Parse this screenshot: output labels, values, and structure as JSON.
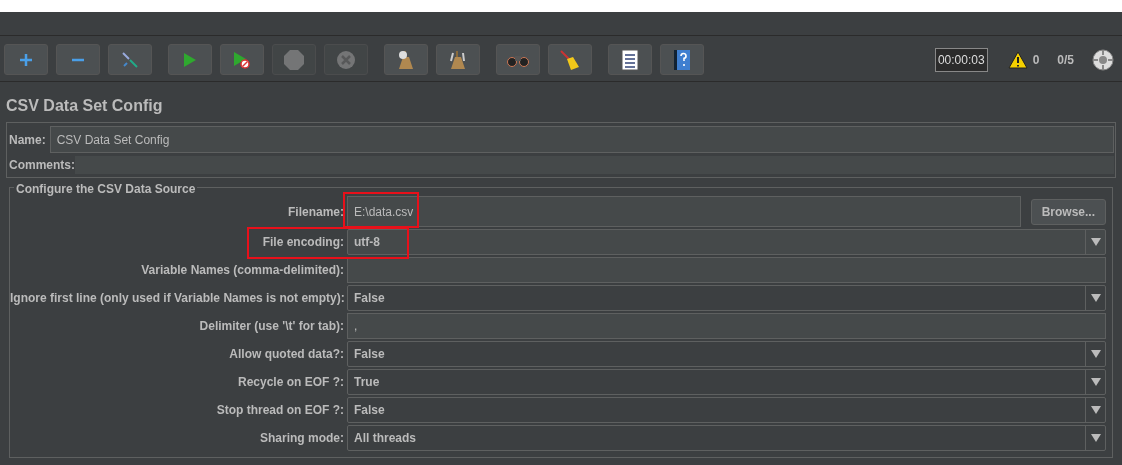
{
  "toolbar": {
    "groups": [
      [
        {
          "kind": "add",
          "disabled": false
        },
        {
          "kind": "remove",
          "disabled": false
        },
        {
          "kind": "toggle",
          "disabled": false
        }
      ],
      [
        {
          "kind": "start",
          "disabled": false
        },
        {
          "kind": "start_no_pause",
          "disabled": false
        },
        {
          "kind": "stop",
          "disabled": true
        },
        {
          "kind": "shutdown",
          "disabled": true
        }
      ],
      [
        {
          "kind": "clear",
          "disabled": false
        },
        {
          "kind": "clear_all",
          "disabled": false
        }
      ],
      [
        {
          "kind": "search",
          "disabled": false
        },
        {
          "kind": "reset_search",
          "disabled": false
        }
      ],
      [
        {
          "kind": "function_helper",
          "disabled": false
        },
        {
          "kind": "help",
          "disabled": false
        }
      ]
    ],
    "timer": "00:00:03",
    "warnings": "0",
    "threads": "0/5"
  },
  "title": "CSV Data Set Config",
  "name": {
    "label": "Name:",
    "value": "CSV Data Set Config"
  },
  "comments": {
    "label": "Comments:"
  },
  "group": {
    "title": "Configure the CSV Data Source",
    "fields": [
      {
        "kind": "file",
        "label": "Filename:",
        "value": "E:\\data.csv",
        "button": "Browse...",
        "highlighted": true
      },
      {
        "kind": "editable_combo",
        "label": "File encoding:",
        "value": "utf-8",
        "highlighted": true
      },
      {
        "kind": "text",
        "label": "Variable Names (comma-delimited):",
        "highlighted": false
      },
      {
        "kind": "combo",
        "label": "Ignore first line (only used if Variable Names is not empty):",
        "value": "False",
        "highlighted": false
      },
      {
        "kind": "text",
        "label": "Delimiter (use '\\t' for tab):",
        "value": ",",
        "highlighted": false
      },
      {
        "kind": "combo",
        "label": "Allow quoted data?:",
        "value": "False",
        "highlighted": false
      },
      {
        "kind": "combo",
        "label": "Recycle on EOF ?:",
        "value": "True",
        "highlighted": false
      },
      {
        "kind": "combo",
        "label": "Stop thread on EOF ?:",
        "value": "False",
        "highlighted": false
      },
      {
        "kind": "combo",
        "label": "Sharing mode:",
        "value": "All threads",
        "highlighted": false
      }
    ]
  }
}
